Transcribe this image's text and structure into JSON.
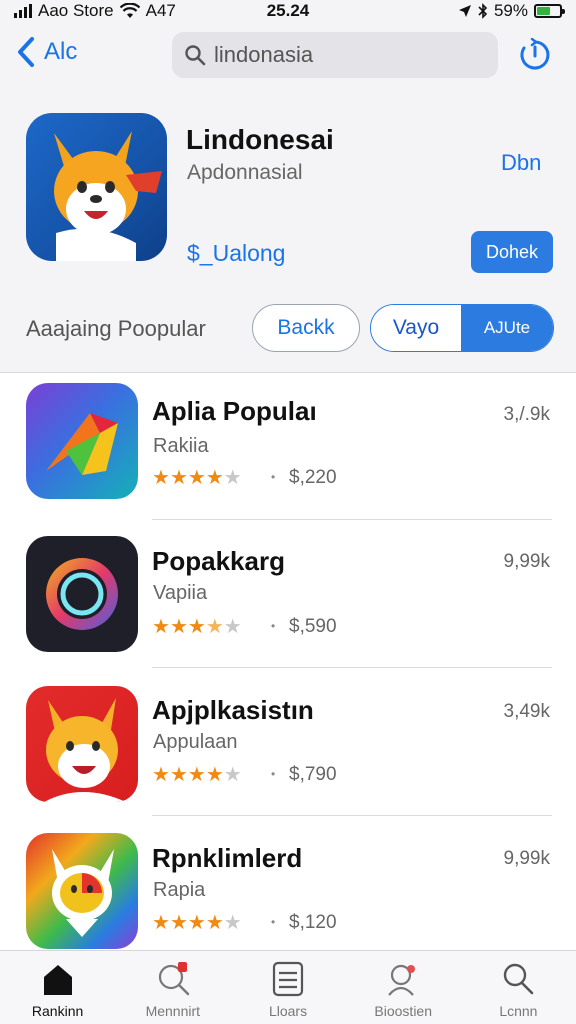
{
  "status_bar": {
    "carrier": "Aao Store",
    "network": "A47",
    "time": "25.24",
    "battery": "59%",
    "battery_level": 0.59
  },
  "nav": {
    "back_label": "Alc",
    "search_value": "lindonasia"
  },
  "featured": {
    "title": "Lindonesai",
    "subtitle": "Apdonnasial",
    "open_label": "Dbn",
    "price_link": "$_Ualong",
    "get_label": "Dohek"
  },
  "section": {
    "label": "Aaajaing Poopular",
    "back_label": "Backk",
    "seg_a": "Vayo",
    "seg_b": "AJUte"
  },
  "apps": [
    {
      "name": "Aplia Populaı",
      "category": "Rakiia",
      "rating": 4,
      "price": "$,220",
      "count": "3,/.9k"
    },
    {
      "name": "Popakkarg",
      "category": "Vapiia",
      "rating": 3.5,
      "price": "$,590",
      "count": "9,99k"
    },
    {
      "name": "Apjplkasistın",
      "category": "Appulaan",
      "rating": 4,
      "price": "$,790",
      "count": "3,49k"
    },
    {
      "name": "Rpnklimlerd",
      "category": "Rapia",
      "rating": 4,
      "price": "$,120",
      "count": "9,99k"
    }
  ],
  "tabs": [
    {
      "label": "Rankinn",
      "icon": "home-icon"
    },
    {
      "label": "Mennnirt",
      "icon": "person-search-icon"
    },
    {
      "label": "Lloars",
      "icon": "list-icon"
    },
    {
      "label": "Bioostien",
      "icon": "people-icon"
    },
    {
      "label": "Lcnnn",
      "icon": "search-icon"
    }
  ],
  "colors": {
    "accent": "#1a73e8",
    "star": "#f08a12",
    "featured_icon": "#1553a8"
  }
}
